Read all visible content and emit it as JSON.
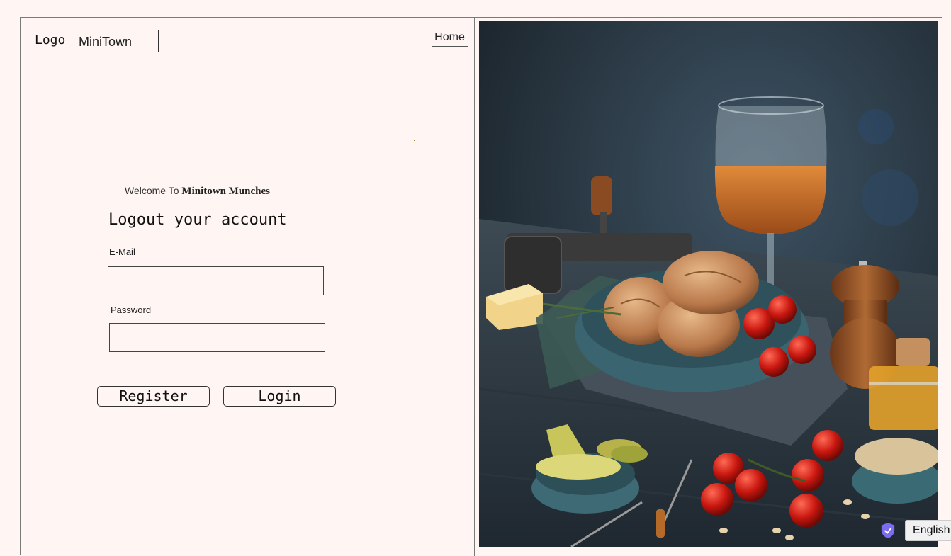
{
  "header": {
    "logo_label": "Logo",
    "brand_name": "MiniTown",
    "home_link": "Home"
  },
  "login_form": {
    "welcome_prefix": "Welcome To ",
    "welcome_brand": "Minitown Munches",
    "title": "Logout your account",
    "email_label": "E-Mail",
    "email_value": "",
    "password_label": "Password",
    "password_value": "",
    "register_button": "Register",
    "login_button": "Login"
  },
  "hero_image": {
    "alt": "Food spread"
  },
  "language_widget": {
    "label": "English",
    "icon": "shield-icon",
    "accent_color": "#7b6cf0"
  }
}
